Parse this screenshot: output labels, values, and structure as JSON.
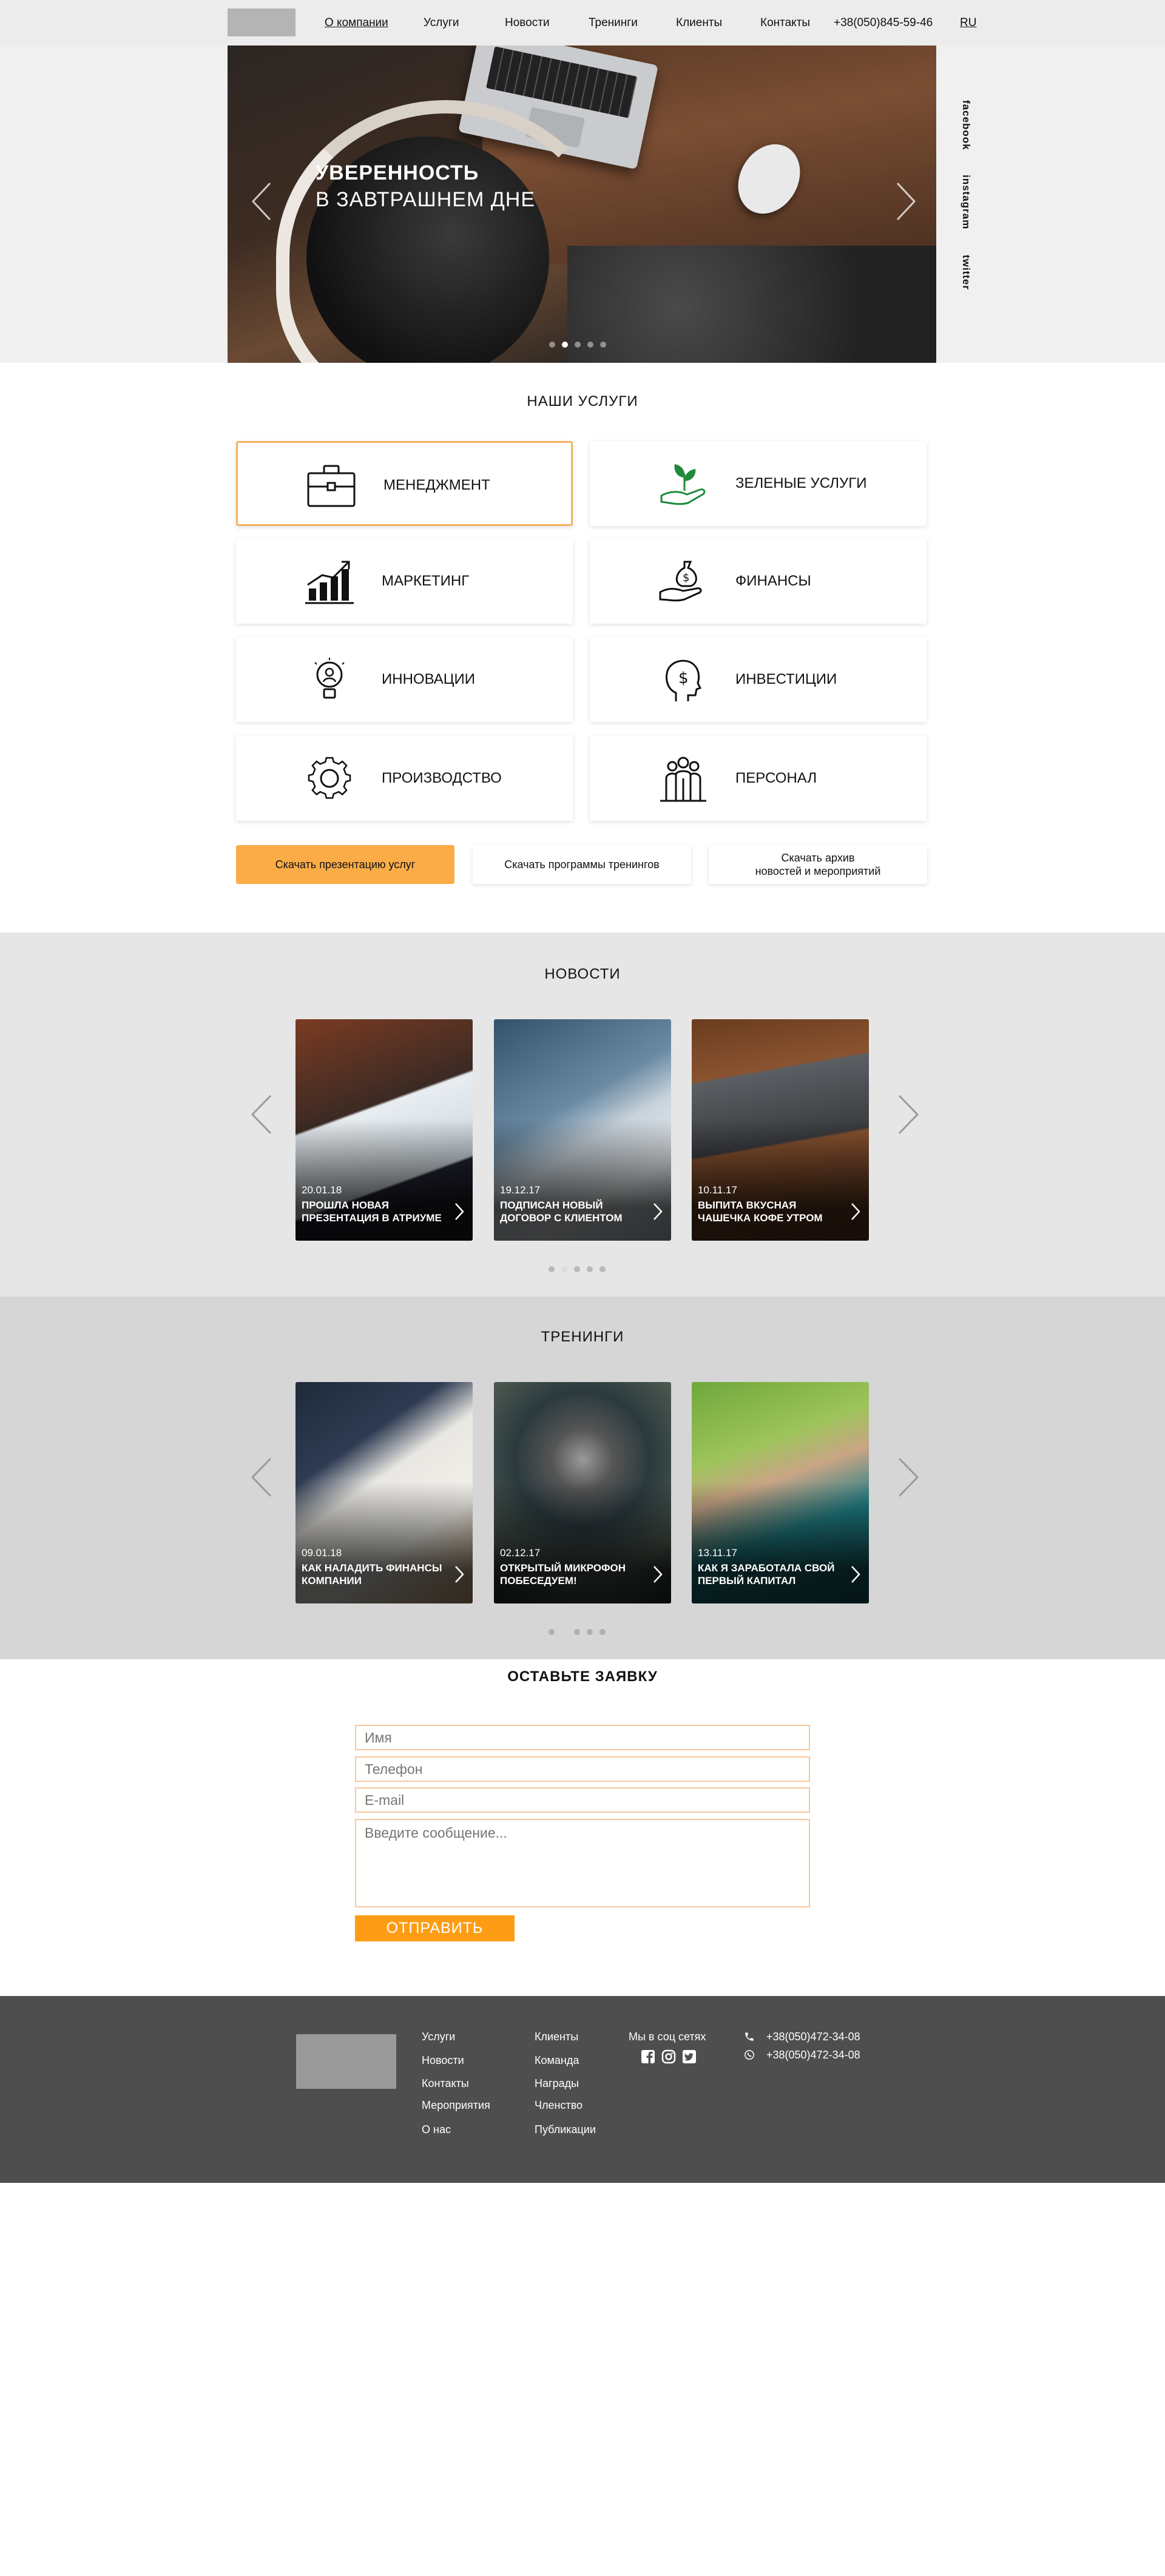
{
  "header": {
    "nav": [
      "О компании",
      "Услуги",
      "Новости",
      "Тренинги",
      "Клиенты",
      "Контакты"
    ],
    "phone": "+38(050)845-59-46",
    "lang": "RU"
  },
  "hero": {
    "title_line1": "УВЕРЕННОСТЬ",
    "title_line2": "В ЗАВТРАШНЕМ ДНЕ",
    "social": [
      "facebook",
      "instagram",
      "twitter"
    ],
    "slides_count": 5,
    "active_slide": 2
  },
  "services": {
    "title": "НАШИ УСЛУГИ",
    "items": [
      {
        "label": "МЕНЕДЖМЕНТ",
        "icon": "briefcase-icon"
      },
      {
        "label": "ЗЕЛЕНЫЕ УСЛУГИ",
        "icon": "plant-hand-icon"
      },
      {
        "label": "МАРКЕТИНГ",
        "icon": "growth-chart-icon"
      },
      {
        "label": "ФИНАНСЫ",
        "icon": "money-bag-hand-icon"
      },
      {
        "label": "ИННОВАЦИИ",
        "icon": "lightbulb-person-icon"
      },
      {
        "label": "ИНВЕСТИЦИИ",
        "icon": "head-dollar-icon"
      },
      {
        "label": "ПРОИЗВОДСТВО",
        "icon": "gear-icon"
      },
      {
        "label": "ПЕРСОНАЛ",
        "icon": "team-icon"
      }
    ],
    "buttons": [
      "Скачать презентацию услуг",
      "Скачать программы тренингов",
      "Скачать архив новостей и мероприятий"
    ],
    "btn3_line1": "Скачать архив",
    "btn3_line2": "новостей и мероприятий"
  },
  "news": {
    "title": "НОВОСТИ",
    "cards": [
      {
        "date": "20.01.18",
        "title": "ПРОШЛА НОВАЯ ПРЕЗЕНТАЦИЯ В АТРИУМЕ"
      },
      {
        "date": "19.12.17",
        "title": "ПОДПИСАН НОВЫЙ ДОГОВОР С КЛИЕНТОМ"
      },
      {
        "date": "10.11.17",
        "title": "ВЫПИТА ВКУСНАЯ ЧАШЕЧКА КОФЕ УТРОМ"
      }
    ]
  },
  "trainings": {
    "title": "ТРЕНИНГИ",
    "cards": [
      {
        "date": "09.01.18",
        "title": "КАК НАЛАДИТЬ ФИНАНСЫ КОМПАНИИ"
      },
      {
        "date": "02.12.17",
        "title": "ОТКРЫТЫЙ МИКРОФОН ПОБЕСЕДУЕМ!"
      },
      {
        "date": "13.11.17",
        "title": "КАК Я ЗАРАБОТАЛА СВОЙ ПЕРВЫЙ КАПИТАЛ"
      }
    ]
  },
  "form": {
    "title": "ОСТАВЬТЕ ЗАЯВКУ",
    "name_placeholder": "Имя",
    "phone_placeholder": "Телефон",
    "email_placeholder": "E-mail",
    "message_placeholder": "Введите сообщение...",
    "submit": "ОТПРАВИТЬ"
  },
  "footer": {
    "col1": [
      "Услуги",
      "Новости",
      "Контакты",
      "Мероприятия",
      "О нас"
    ],
    "col2": [
      "Клиенты",
      "Команда",
      "Награды",
      "Членство",
      "Публикации"
    ],
    "social_title": "Мы в соц сетях",
    "phone1": "+38(050)472-34-08",
    "phone2": "+38(050)472-34-08"
  },
  "colors": {
    "accent": "#fbac47",
    "submit": "#fe9d15",
    "footer_bg": "#4e4e4e"
  }
}
